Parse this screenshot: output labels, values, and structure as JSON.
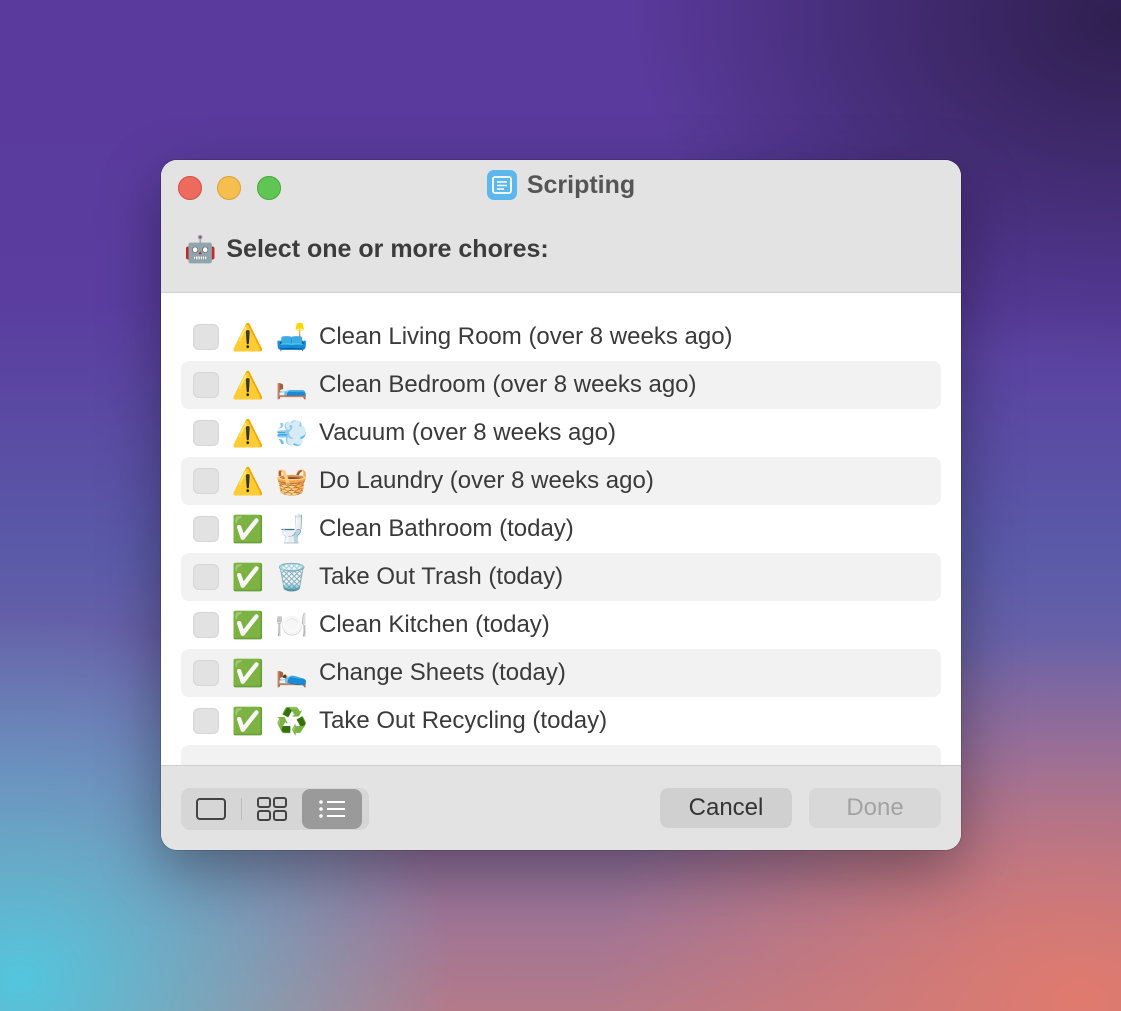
{
  "window": {
    "title": "Scripting",
    "app_icon": "list-document-icon"
  },
  "prompt": {
    "emoji": "🤖",
    "text": "Select one or more chores:"
  },
  "chores": [
    {
      "status": "⚠️",
      "emoji": "🛋️",
      "label": "Clean Living Room (over 8 weeks ago)",
      "checked": false
    },
    {
      "status": "⚠️",
      "emoji": "🛏️",
      "label": "Clean Bedroom (over 8 weeks ago)",
      "checked": false
    },
    {
      "status": "⚠️",
      "emoji": "💨",
      "label": "Vacuum (over 8 weeks ago)",
      "checked": false
    },
    {
      "status": "⚠️",
      "emoji": "🧺",
      "label": "Do Laundry (over 8 weeks ago)",
      "checked": false
    },
    {
      "status": "✅",
      "emoji": "🚽",
      "label": "Clean Bathroom (today)",
      "checked": false
    },
    {
      "status": "✅",
      "emoji": "🗑️",
      "label": "Take Out Trash (today)",
      "checked": false
    },
    {
      "status": "✅",
      "emoji": "🍽️",
      "label": "Clean Kitchen (today)",
      "checked": false
    },
    {
      "status": "✅",
      "emoji": "🛌",
      "label": "Change Sheets (today)",
      "checked": false
    },
    {
      "status": "✅",
      "emoji": "♻️",
      "label": "Take Out Recycling (today)",
      "checked": false
    }
  ],
  "footer": {
    "view_modes": [
      "single-view-icon",
      "grid-view-icon",
      "list-view-icon"
    ],
    "active_view": "list-view-icon",
    "cancel_label": "Cancel",
    "done_label": "Done"
  }
}
